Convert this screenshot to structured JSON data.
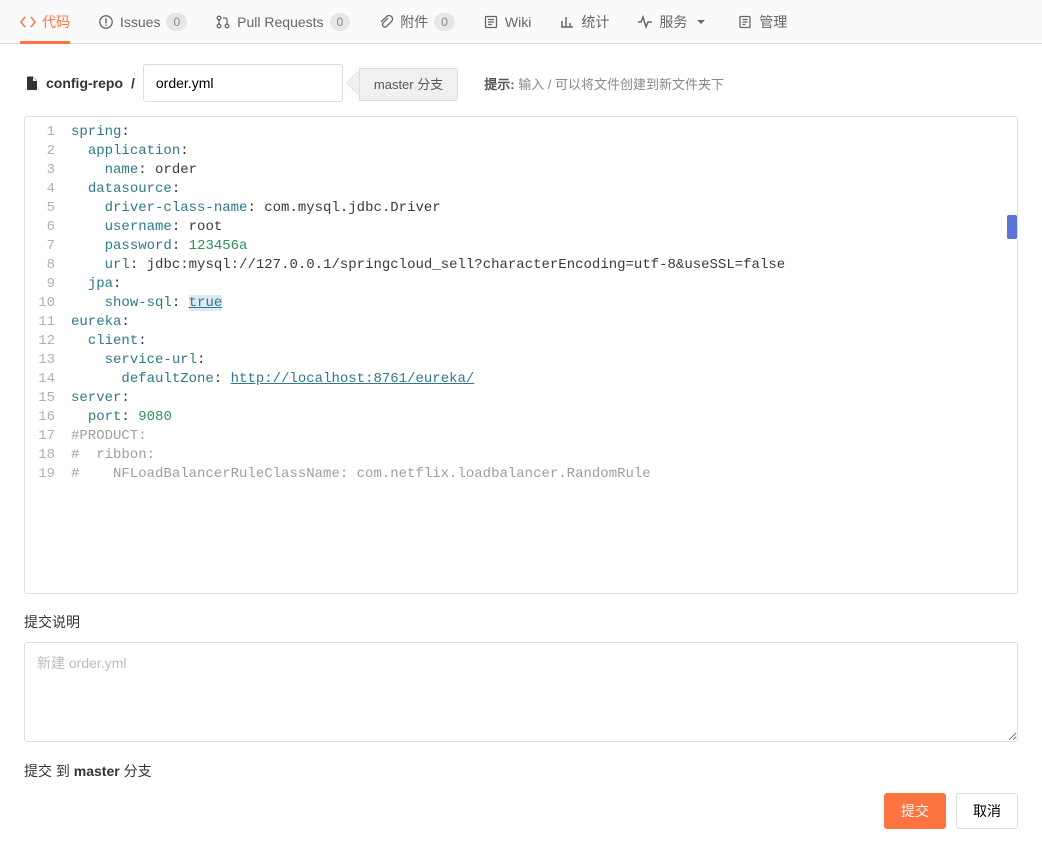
{
  "tabs": {
    "code": "代码",
    "issues": "Issues",
    "issues_count": "0",
    "pulls": "Pull Requests",
    "pulls_count": "0",
    "attach": "附件",
    "attach_count": "0",
    "wiki": "Wiki",
    "stats": "统计",
    "services": "服务",
    "admin": "管理"
  },
  "path": {
    "repo": "config-repo",
    "sep": "/",
    "filename_value": "order.yml",
    "branch_label": "master 分支"
  },
  "hint": {
    "prefix": "提示:",
    "text": " 输入 / 可以将文件创建到新文件夹下"
  },
  "code_lines": [
    {
      "n": "1",
      "html": "<span class='k'>spring</span><span class='p'>:</span>"
    },
    {
      "n": "2",
      "html": "  <span class='k'>application</span><span class='p'>:</span>"
    },
    {
      "n": "3",
      "html": "    <span class='k'>name</span><span class='p'>:</span> <span class='s'>order</span>"
    },
    {
      "n": "4",
      "html": "  <span class='k'>datasource</span><span class='p'>:</span>"
    },
    {
      "n": "5",
      "html": "    <span class='k'>driver-class-name</span><span class='p'>:</span> <span class='s'>com.mysql.jdbc.Driver</span>"
    },
    {
      "n": "6",
      "html": "    <span class='k'>username</span><span class='p'>:</span> <span class='s'>root</span>"
    },
    {
      "n": "7",
      "html": "    <span class='k'>password</span><span class='p'>:</span> <span class='g'>123456a</span>"
    },
    {
      "n": "8",
      "html": "    <span class='k'>url</span><span class='p'>:</span> <span class='s'>jdbc:mysql://127.0.0.1/springcloud_sell?characterEncoding=utf-8&amp;useSSL=false</span>"
    },
    {
      "n": "9",
      "html": "  <span class='k'>jpa</span><span class='p'>:</span>"
    },
    {
      "n": "10",
      "html": "    <span class='k'>show-sql</span><span class='p'>:</span> <span class='bool'>true</span>"
    },
    {
      "n": "11",
      "html": "<span class='k'>eureka</span><span class='p'>:</span>"
    },
    {
      "n": "12",
      "html": "  <span class='k'>client</span><span class='p'>:</span>"
    },
    {
      "n": "13",
      "html": "    <span class='k'>service-url</span><span class='p'>:</span>"
    },
    {
      "n": "14",
      "html": "      <span class='k'>defaultZone</span><span class='p'>:</span> <span class='url'>http://localhost:8761/eureka/</span>"
    },
    {
      "n": "15",
      "html": "<span class='k'>server</span><span class='p'>:</span>"
    },
    {
      "n": "16",
      "html": "  <span class='k'>port</span><span class='p'>:</span> <span class='g'>9080</span>"
    },
    {
      "n": "17",
      "html": "<span class='com'>#PRODUCT:</span>"
    },
    {
      "n": "18",
      "html": "<span class='com'>#  ribbon:</span>"
    },
    {
      "n": "19",
      "html": "<span class='com'>#    NFLoadBalancerRuleClassName: com.netflix.loadbalancer.RandomRule</span>"
    }
  ],
  "commit": {
    "heading": "提交说明",
    "placeholder": "新建 order.yml",
    "branch_line_pre": "提交 到 ",
    "branch_line_branch": "master",
    "branch_line_post": " 分支",
    "submit": "提交",
    "cancel": "取消"
  }
}
